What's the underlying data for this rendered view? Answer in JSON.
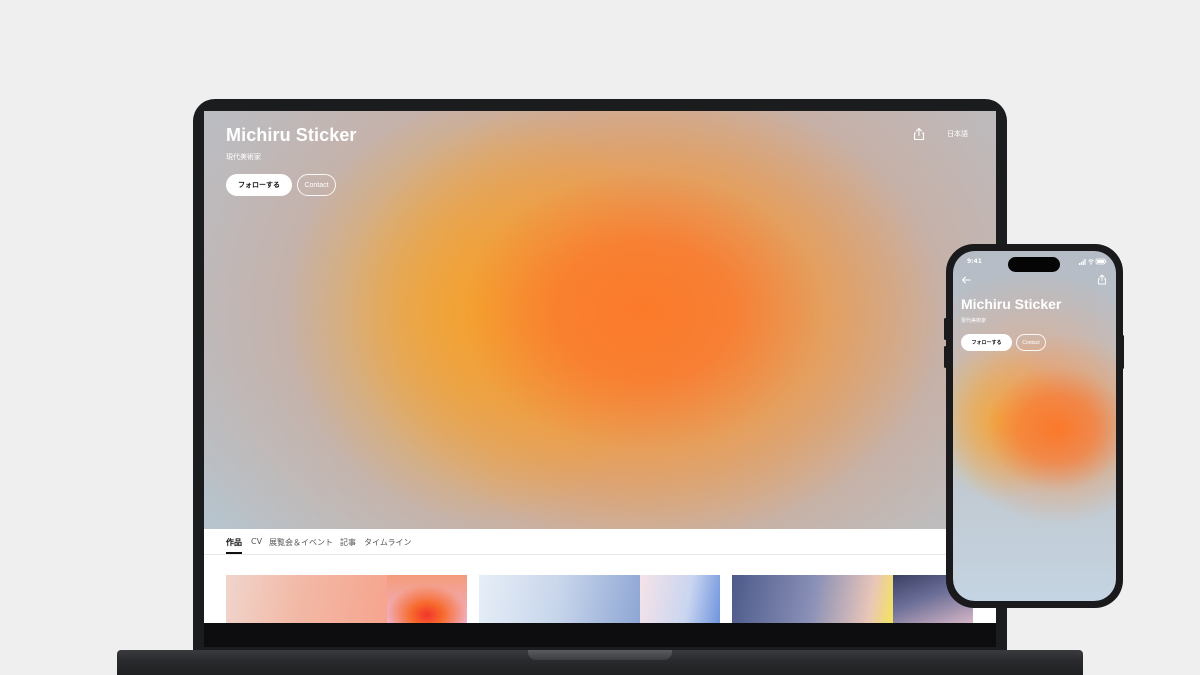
{
  "profile": {
    "name": "Michiru Sticker",
    "role": "現代美術家",
    "follow_label": "フォローする",
    "contact_label": "Contact",
    "language_label": "日本語"
  },
  "tabs": [
    {
      "label": "作品",
      "active": true
    },
    {
      "label": "CV",
      "active": false
    },
    {
      "label": "展覧会＆イベント",
      "active": false
    },
    {
      "label": "記事",
      "active": false
    },
    {
      "label": "タイムライン",
      "active": false
    }
  ],
  "phone": {
    "time": "9:41"
  },
  "icons": {
    "share": "share-icon",
    "back": "back-arrow-icon",
    "signal": "signal-icon",
    "wifi": "wifi-icon",
    "battery": "battery-icon"
  },
  "colors": {
    "accent_orange": "#fb7a2a",
    "accent_yellow": "#f5af28",
    "sky_blue": "#b3c8d6",
    "text_dark": "#111111"
  }
}
